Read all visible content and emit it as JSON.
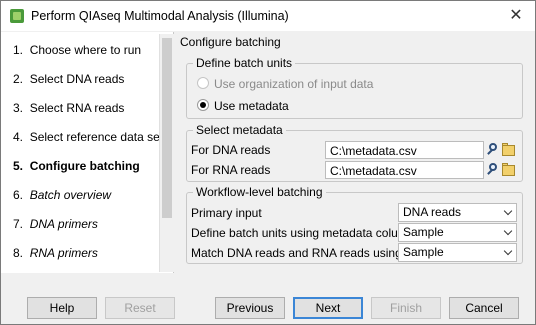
{
  "window": {
    "title": "Perform QIAseq Multimodal Analysis (Illumina)",
    "close_icon": "close-icon",
    "app_icon": "clc-workbench-icon"
  },
  "steps": [
    {
      "num": "1.",
      "label": "Choose where to run",
      "state": "done"
    },
    {
      "num": "2.",
      "label": "Select DNA reads",
      "state": "done"
    },
    {
      "num": "3.",
      "label": "Select RNA reads",
      "state": "done"
    },
    {
      "num": "4.",
      "label": "Select reference data set",
      "state": "done"
    },
    {
      "num": "5.",
      "label": "Configure batching",
      "state": "current"
    },
    {
      "num": "6.",
      "label": "Batch overview",
      "state": "pending"
    },
    {
      "num": "7.",
      "label": "DNA primers",
      "state": "pending"
    },
    {
      "num": "8.",
      "label": "RNA primers",
      "state": "pending"
    }
  ],
  "content": {
    "title": "Configure batching",
    "batch_units": {
      "legend": "Define batch units",
      "option_org": "Use organization of input data",
      "option_org_enabled": false,
      "option_meta": "Use metadata",
      "selected": "Use metadata"
    },
    "metadata": {
      "legend": "Select metadata",
      "dna_label": "For DNA reads",
      "dna_value": "C:\\metadata.csv",
      "rna_label": "For RNA reads",
      "rna_value": "C:\\metadata.csv"
    },
    "workflow": {
      "legend": "Workflow-level batching",
      "primary_label": "Primary input",
      "primary_value": "DNA reads",
      "define_label": "Define batch units using metadata column",
      "define_value": "Sample",
      "match_label": "Match DNA reads and RNA reads using",
      "match_value": "Sample"
    }
  },
  "buttons": {
    "help": "Help",
    "reset": "Reset",
    "previous": "Previous",
    "next": "Next",
    "finish": "Finish",
    "cancel": "Cancel"
  },
  "colors": {
    "default_button_border": "#3b86d6",
    "window_bg": "#f0f0f0"
  }
}
